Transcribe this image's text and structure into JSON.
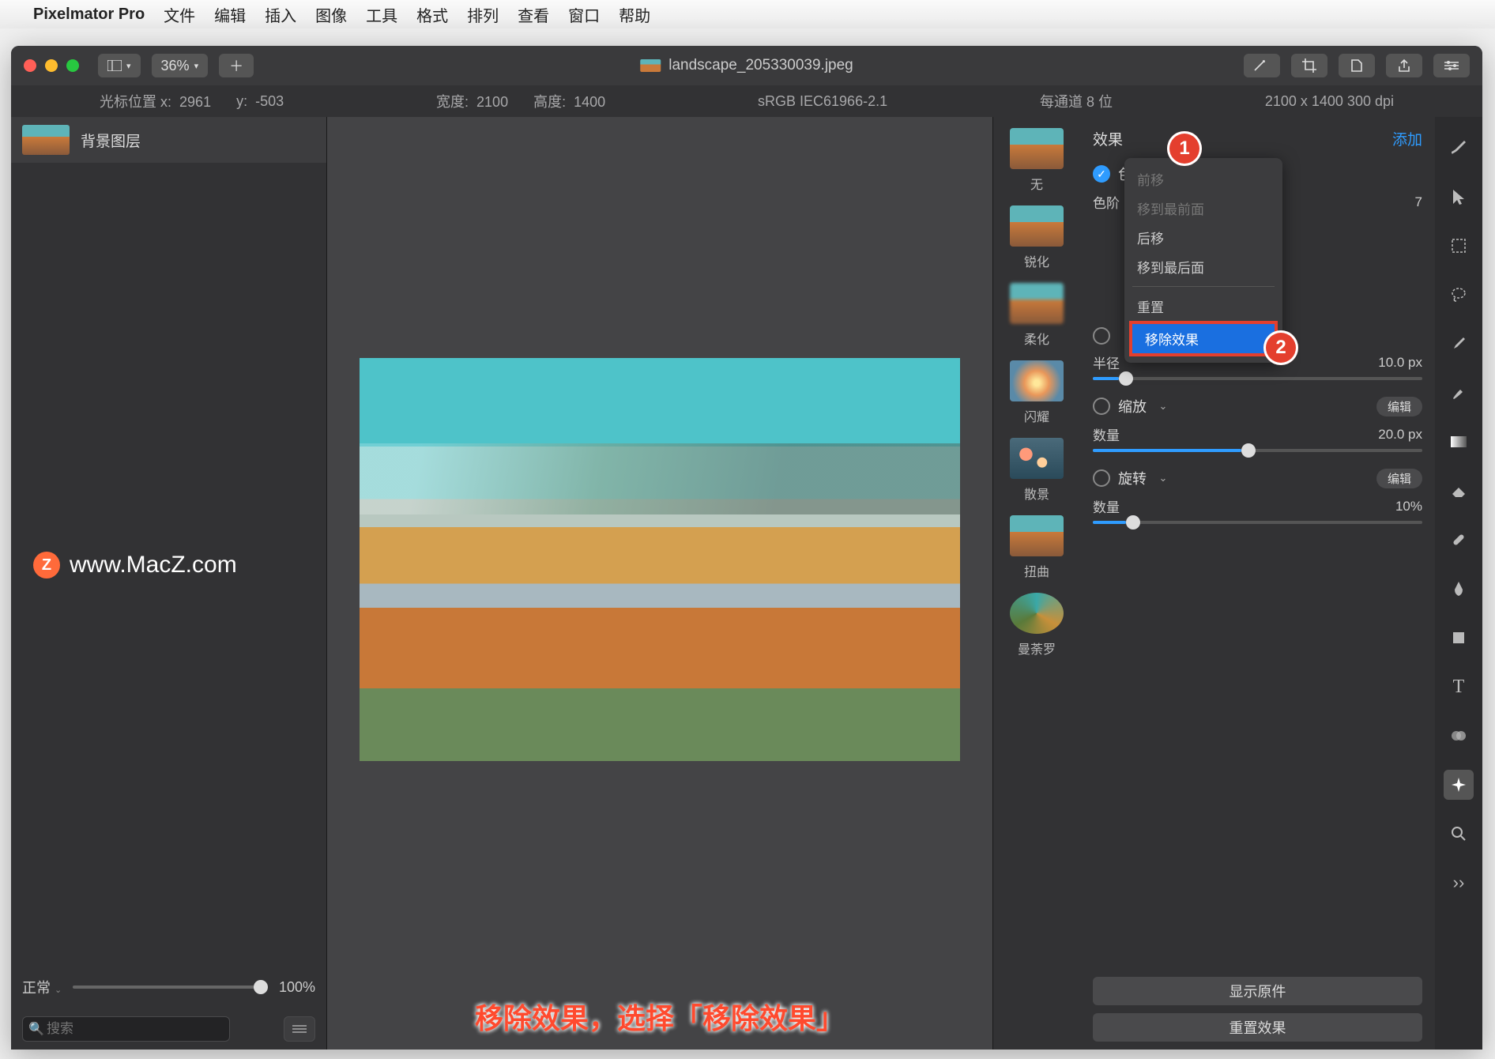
{
  "menubar": {
    "app": "Pixelmator Pro",
    "items": [
      "文件",
      "编辑",
      "插入",
      "图像",
      "工具",
      "格式",
      "排列",
      "查看",
      "窗口",
      "帮助"
    ]
  },
  "toolbar": {
    "zoom": "36%",
    "document_title": "landscape_205330039.jpeg"
  },
  "infobar": {
    "cursor_label": "光标位置 x:",
    "cursor_x": "2961",
    "cursor_y_label": "y:",
    "cursor_y": "-503",
    "width_label": "宽度:",
    "width": "2100",
    "height_label": "高度:",
    "height": "1400",
    "color_profile": "sRGB IEC61966-2.1",
    "bit_depth": "每通道 8 位",
    "dimensions_dpi": "2100 x 1400 300 dpi"
  },
  "layers": {
    "items": [
      {
        "name": "背景图层"
      }
    ],
    "blend_mode": "正常",
    "opacity": "100%",
    "search_placeholder": "搜索"
  },
  "effects": {
    "header_label": "效果",
    "add_label": "添加",
    "presets": [
      {
        "name": "无",
        "style": ""
      },
      {
        "name": "锐化",
        "style": ""
      },
      {
        "name": "柔化",
        "style": "blur"
      },
      {
        "name": "闪耀",
        "style": "flare"
      },
      {
        "name": "散景",
        "style": "bokeh"
      },
      {
        "name": "扭曲",
        "style": ""
      },
      {
        "name": "曼荼罗",
        "style": "kal"
      }
    ],
    "applied": [
      {
        "name": "色调分离",
        "enabled": true,
        "param_label": "色阶",
        "param_value": "7",
        "slider_pct": 0
      },
      {
        "name": "",
        "enabled": false,
        "param_label": "半径",
        "param_value": "10.0 px",
        "slider_pct": 8
      },
      {
        "name": "缩放",
        "enabled": false,
        "edit": "编辑",
        "param_label": "数量",
        "param_value": "20.0 px",
        "slider_pct": 45
      },
      {
        "name": "旋转",
        "enabled": false,
        "edit": "编辑",
        "param_label": "数量",
        "param_value": "10%",
        "slider_pct": 10
      }
    ],
    "context_menu": {
      "items": [
        {
          "label": "前移",
          "dim": true
        },
        {
          "label": "移到最前面",
          "dim": true
        },
        {
          "label": "后移"
        },
        {
          "label": "移到最后面"
        },
        {
          "label": "重置"
        },
        {
          "label": "移除效果",
          "selected": true
        }
      ]
    },
    "bottom_buttons": {
      "show_original": "显示原件",
      "reset_effects": "重置效果"
    }
  },
  "callouts": {
    "one": "1",
    "two": "2"
  },
  "watermark": "www.MacZ.com",
  "caption": "移除效果，选择「移除效果」"
}
